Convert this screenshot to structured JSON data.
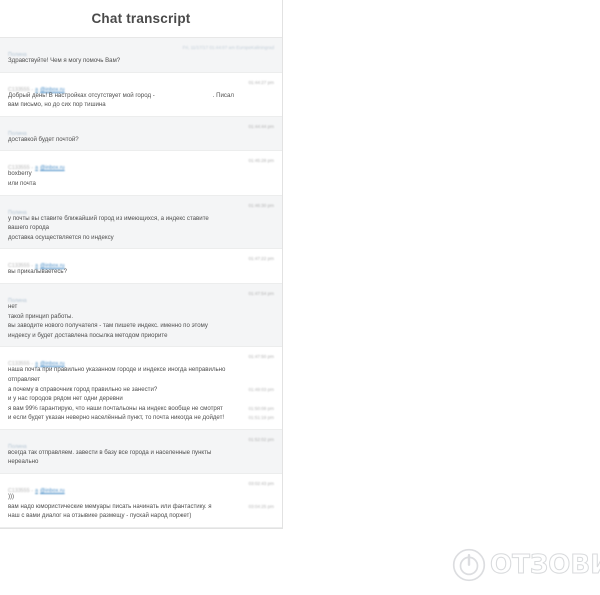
{
  "panel": {
    "title": "Chat transcript"
  },
  "watermark": {
    "text": "ОТЗОВИК",
    "logo_icon": "power-circle-icon"
  },
  "labels": {
    "agent_name": "Полина",
    "client_id": "C133555 -",
    "client_link_a": "a",
    "client_email": "@inbox.ru"
  },
  "messages": [
    {
      "role": "agent",
      "sender": "Полина",
      "time": "Fri, 11/17/17 01:44:07 am EuropeKaliningrad",
      "lines": [
        {
          "text": "Здравствуйте! Чем я могу помочь Вам?",
          "time": ""
        }
      ]
    },
    {
      "role": "client",
      "sender_id": "C133555 -",
      "sender_a": "a",
      "sender_email": "@inbox.ru",
      "time": "01:44:27 pm",
      "lines": [
        {
          "text": "Добрый день! В настройках отсутствует мой город -",
          "gap": ". Писал",
          "time": ""
        },
        {
          "text": "вам письмо, но до сих пор тишина",
          "time": ""
        }
      ]
    },
    {
      "role": "agent",
      "sender": "Полина",
      "time": "01:44:44 pm",
      "lines": [
        {
          "text": "доставкой будет почтой?",
          "time": ""
        }
      ]
    },
    {
      "role": "client",
      "sender_id": "C133555 -",
      "sender_a": "a",
      "sender_email": "@inbox.ru",
      "time": "01:45:28 pm",
      "lines": [
        {
          "text": "boxberry",
          "time": ""
        },
        {
          "text": "или почта",
          "time": ""
        }
      ]
    },
    {
      "role": "agent",
      "sender": "Полина",
      "time": "01:46:30 pm",
      "lines": [
        {
          "text": "у почты вы ставите ближайший город из имеющихся, а индекс ставите",
          "time": ""
        },
        {
          "text": "вашего города",
          "time": ""
        },
        {
          "text": "доставка осуществляется по индексу",
          "time": ""
        }
      ]
    },
    {
      "role": "client",
      "sender_id": "C133555 -",
      "sender_a": "a",
      "sender_email": "@inbox.ru",
      "time": "01:47:22 pm",
      "lines": [
        {
          "text": "вы прикалываетесь?",
          "time": ""
        }
      ]
    },
    {
      "role": "agent",
      "sender": "Полина",
      "time": "01:47:54 pm",
      "lines": [
        {
          "text": "нет",
          "time": ""
        },
        {
          "text": "такой принцип работы.",
          "time": ""
        },
        {
          "text": "вы заводите нового получателя - там пишете индекс. именно по этому",
          "time": ""
        },
        {
          "text": "индексу и будет доставлена посылка методом приорите",
          "time": ""
        }
      ]
    },
    {
      "role": "client",
      "sender_id": "C133555 -",
      "sender_a": "a",
      "sender_email": "@inbox.ru",
      "time": "01:47:50 pm",
      "lines": [
        {
          "text": "наша почта при правильно указанном городе и индексе иногда неправильно",
          "time": ""
        },
        {
          "text": "отправляет",
          "time": ""
        },
        {
          "text": "а почему в справочник город правильно не занести?",
          "time": "01:49:03 pm"
        },
        {
          "text": "и у нас городов рядом нет одни деревни",
          "time": ""
        },
        {
          "text": "я вам 99% гарантирую, что наши почтальоны на индекс вообще не смотрят",
          "time": "01:50:08 pm"
        },
        {
          "text": "и если будет указан неверно населённый пункт, то почта никогда не дойдет!",
          "time": "01:51:19 pm"
        }
      ]
    },
    {
      "role": "agent",
      "sender": "Полина",
      "time": "01:52:02 pm",
      "lines": [
        {
          "text": "всегда так отправляем. завести в базу все города и населенные пункты",
          "time": ""
        },
        {
          "text": "нереально",
          "time": ""
        }
      ]
    },
    {
      "role": "client",
      "sender_id": "C133555 -",
      "sender_a": "a",
      "sender_email": "@inbox.ru",
      "time": "03:02:43 pm",
      "lines": [
        {
          "text": ")))",
          "time": ""
        },
        {
          "text": "вам надо юмористические мемуары писать начинать или фантастику. я",
          "time": "03:04:25 pm"
        },
        {
          "text": "наш с вами диалог на отзывике размещу - пускай народ поржет)",
          "time": ""
        }
      ]
    }
  ]
}
